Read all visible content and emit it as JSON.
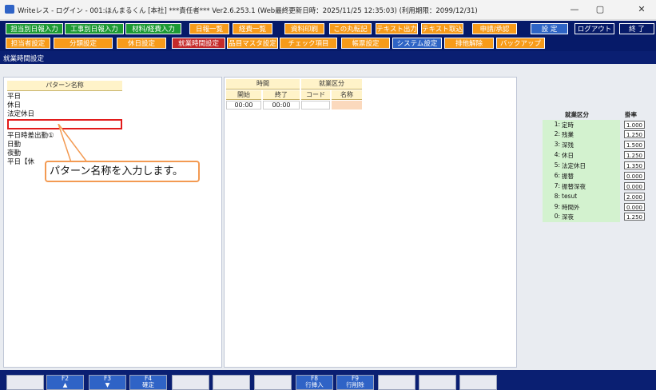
{
  "window": {
    "title": "Writeレス - ログイン - 001:ほんまるくん [本社] ***責任者*** Ver2.6.253.1 (Web最終更新日時：2025/11/25 12:35:03) (利用期限：2099/12/31)",
    "minimize": "—",
    "maximize": "▢",
    "close": "✕"
  },
  "menu": {
    "row1": [
      "担当別日報入力",
      "工事別日報入力",
      "材料/経費入力",
      "日報一覧",
      "経費一覧",
      "資料印刷",
      "この丸転記",
      "テキスト出力",
      "テキスト取込",
      "申請/承認",
      "設 定",
      "ログアウト",
      "終 了"
    ],
    "row2": [
      "担当者設定",
      "分類設定",
      "休日設定",
      "就業時間設定",
      "品目マスタ設定",
      "チェック項目",
      "帳票設定",
      "システム設定",
      "排他解除",
      "バックアップ"
    ]
  },
  "screen_title": "就業時間設定",
  "pattern_panel": {
    "header": "パターン名称",
    "items": [
      "平日",
      "休日",
      "法定休日",
      "",
      "平日時差出勤①",
      "日勤",
      "夜勤",
      "平日【休"
    ]
  },
  "callout": "パターン名称を入力します。",
  "time_panel": {
    "group_time": "時間",
    "group_kubun": "就業区分",
    "col_start": "開始",
    "col_end": "終了",
    "col_code": "コード",
    "col_name": "名称",
    "row_start": "00:00",
    "row_end": "00:00",
    "row_code": "",
    "row_name": ""
  },
  "kubun_table": {
    "header_name": "就業区分",
    "header_rate": "掛率",
    "rows": [
      {
        "num": "1:",
        "name": "定時",
        "rate": "1.000"
      },
      {
        "num": "2:",
        "name": "残業",
        "rate": "1.250"
      },
      {
        "num": "3:",
        "name": "深残",
        "rate": "1.500"
      },
      {
        "num": "4:",
        "name": "休日",
        "rate": "1.250"
      },
      {
        "num": "5:",
        "name": "法定休日",
        "rate": "1.350"
      },
      {
        "num": "6:",
        "name": "振替",
        "rate": "0.000"
      },
      {
        "num": "7:",
        "name": "振替深夜",
        "rate": "0.000"
      },
      {
        "num": "8:",
        "name": "tesut",
        "rate": "2.000"
      },
      {
        "num": "9:",
        "name": "時間外",
        "rate": "0.000"
      },
      {
        "num": "0:",
        "name": "深夜",
        "rate": "1.250"
      }
    ]
  },
  "function_keys": [
    {
      "key": "",
      "label": ""
    },
    {
      "key": "F2",
      "label": "▲"
    },
    {
      "key": "F3",
      "label": "▼"
    },
    {
      "key": "F4",
      "label": "確定"
    },
    {
      "key": "",
      "label": ""
    },
    {
      "key": "",
      "label": ""
    },
    {
      "key": "",
      "label": ""
    },
    {
      "key": "F8",
      "label": "行挿入"
    },
    {
      "key": "F9",
      "label": "行削除"
    },
    {
      "key": "",
      "label": ""
    },
    {
      "key": "",
      "label": ""
    },
    {
      "key": "",
      "label": ""
    }
  ]
}
